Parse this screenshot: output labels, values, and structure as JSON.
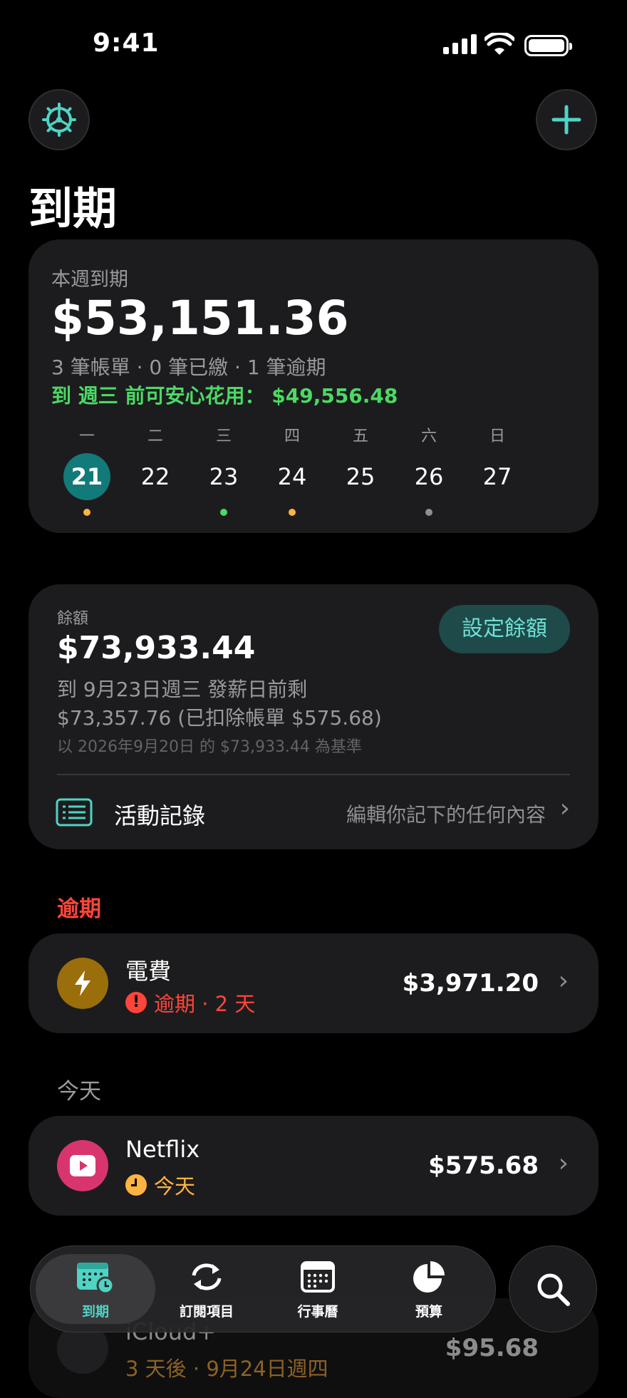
{
  "status_bar": {
    "time": "9:41"
  },
  "header": {
    "title": "到期",
    "settings_icon": "gear-icon",
    "add_icon": "plus-icon"
  },
  "colors": {
    "accent": "#4fd3c4",
    "green": "#4cd964",
    "overdue": "#ff453a",
    "today": "#ffb340",
    "card": "#1c1c1e"
  },
  "week": {
    "label": "本週到期",
    "total": "$53,151.36",
    "summary": "3 筆帳單 · 0 筆已繳 · 1 筆逾期",
    "safe_prefix": "到 週三 前可安心花用：",
    "safe_amount": "$49,556.48",
    "days": [
      {
        "weekday": "一",
        "date": "21",
        "selected": true,
        "dot": "#ffb340"
      },
      {
        "weekday": "二",
        "date": "22",
        "dot": ""
      },
      {
        "weekday": "三",
        "date": "23",
        "dot": "#4cd964"
      },
      {
        "weekday": "四",
        "date": "24",
        "dot": "#ffb340"
      },
      {
        "weekday": "五",
        "date": "25",
        "dot": ""
      },
      {
        "weekday": "六",
        "date": "26",
        "dot": "#8e8e93"
      },
      {
        "weekday": "日",
        "date": "27",
        "dot": ""
      }
    ]
  },
  "balance": {
    "label": "餘額",
    "amount": "$73,933.44",
    "set_button": "設定餘額",
    "line1": "到 9月23日週三 發薪日前剩",
    "line2": "$73,357.76 (已扣除帳單 $575.68)",
    "baseline": "以 2026年9月20日 的 $73,933.44 為基準",
    "activity_label": "活動記錄",
    "activity_hint": "編輯你記下的任何內容"
  },
  "overdue": {
    "heading": "逾期",
    "item": {
      "name": "電費",
      "status": "逾期 · 2 天",
      "amount": "$3,971.20",
      "icon": "lightning-icon"
    }
  },
  "today": {
    "heading": "今天",
    "item": {
      "name": "Netflix",
      "status": "今天",
      "amount": "$575.68",
      "icon": "play-icon"
    }
  },
  "upcoming_partial": {
    "name": "iCloud+",
    "status": "3 天後 · 9月24日週四",
    "amount": "$95.68"
  },
  "tabs": [
    {
      "label": "到期",
      "icon": "calendar-clock-icon",
      "active": true
    },
    {
      "label": "訂閱項目",
      "icon": "repeat-icon"
    },
    {
      "label": "行事曆",
      "icon": "calendar-icon"
    },
    {
      "label": "預算",
      "icon": "pie-chart-icon"
    }
  ],
  "search_icon": "search-icon"
}
